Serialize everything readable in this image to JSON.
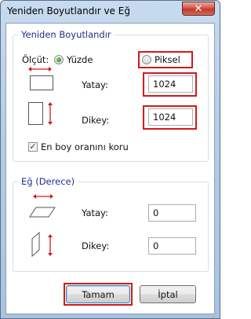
{
  "window": {
    "title": "Yeniden Boyutlandır ve Eğ",
    "close_glyph": "✕",
    "close_icon": "close-icon"
  },
  "resize": {
    "legend": "Yeniden Boyutlandır",
    "unit_label": "Ölçüt:",
    "options": [
      {
        "label": "Yüzde",
        "selected": true
      },
      {
        "label": "Piksel",
        "selected": false
      }
    ],
    "horizontal": {
      "label": "Yatay:",
      "value": "1024",
      "icon": "resize-horizontal-icon"
    },
    "vertical": {
      "label": "Dikey:",
      "value": "1024",
      "icon": "resize-vertical-icon"
    },
    "aspect": {
      "label": "En boy oranını koru",
      "checked": true
    }
  },
  "skew": {
    "legend": "Eğ (Derece)",
    "horizontal": {
      "label": "Yatay:",
      "value": "0",
      "icon": "skew-horizontal-icon"
    },
    "vertical": {
      "label": "Dikey:",
      "value": "0",
      "icon": "skew-vertical-icon"
    }
  },
  "buttons": {
    "ok": "Tamam",
    "cancel": "İptal"
  },
  "colors": {
    "highlight": "#d11a1a",
    "arrow": "#d11a1a",
    "legend_text": "#1e3287"
  }
}
